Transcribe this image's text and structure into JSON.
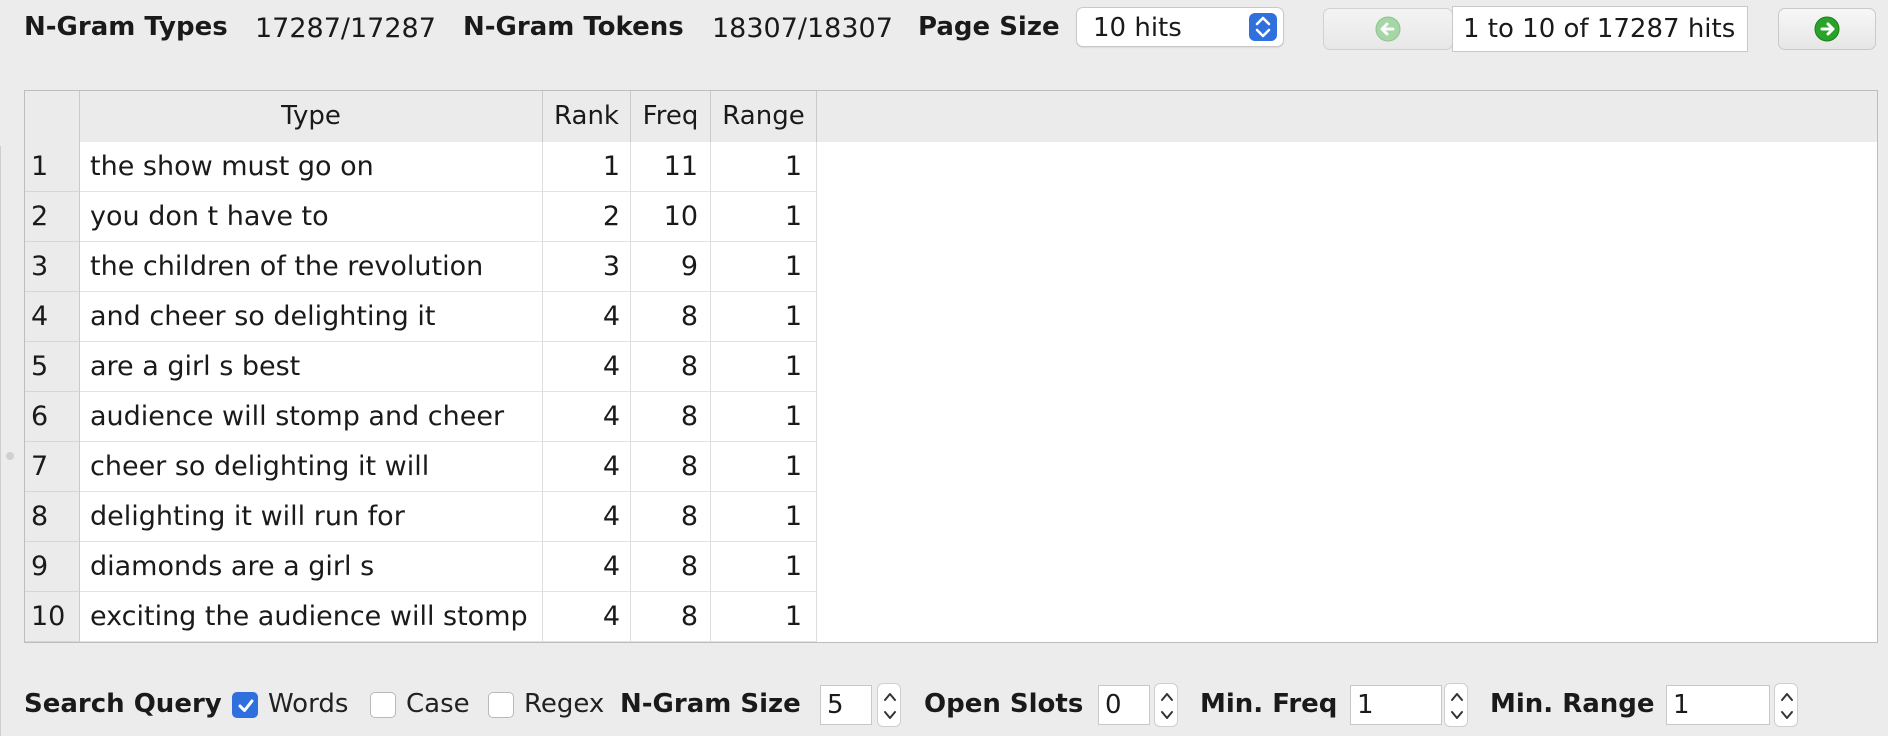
{
  "stats": {
    "types_label": "N-Gram Types",
    "types_value": "17287/17287",
    "tokens_label": "N-Gram Tokens",
    "tokens_value": "18307/18307"
  },
  "paging": {
    "page_size_label": "Page Size",
    "page_size_value": "10 hits",
    "hits_range": "1 to 10 of 17287 hits"
  },
  "table": {
    "headers": [
      "Type",
      "Rank",
      "Freq",
      "Range"
    ],
    "rows": [
      {
        "num": "1",
        "type": "the show must go on",
        "rank": "1",
        "freq": "11",
        "range": "1"
      },
      {
        "num": "2",
        "type": "you don t have to",
        "rank": "2",
        "freq": "10",
        "range": "1"
      },
      {
        "num": "3",
        "type": "the children of the revolution",
        "rank": "3",
        "freq": "9",
        "range": "1"
      },
      {
        "num": "4",
        "type": "and cheer so delighting it",
        "rank": "4",
        "freq": "8",
        "range": "1"
      },
      {
        "num": "5",
        "type": "are a girl s best",
        "rank": "4",
        "freq": "8",
        "range": "1"
      },
      {
        "num": "6",
        "type": "audience will stomp and cheer",
        "rank": "4",
        "freq": "8",
        "range": "1"
      },
      {
        "num": "7",
        "type": "cheer so delighting it will",
        "rank": "4",
        "freq": "8",
        "range": "1"
      },
      {
        "num": "8",
        "type": "delighting it will run for",
        "rank": "4",
        "freq": "8",
        "range": "1"
      },
      {
        "num": "9",
        "type": "diamonds are a girl s",
        "rank": "4",
        "freq": "8",
        "range": "1"
      },
      {
        "num": "10",
        "type": "exciting the audience will stomp",
        "rank": "4",
        "freq": "8",
        "range": "1"
      }
    ]
  },
  "search": {
    "query_label": "Search Query",
    "words_label": "Words",
    "words_checked": true,
    "case_label": "Case",
    "case_checked": false,
    "regex_label": "Regex",
    "regex_checked": false,
    "ngram_size_label": "N-Gram Size",
    "ngram_size_value": "5",
    "open_slots_label": "Open Slots",
    "open_slots_value": "0",
    "min_freq_label": "Min. Freq",
    "min_freq_value": "1",
    "min_range_label": "Min. Range",
    "min_range_value": "1"
  },
  "colors": {
    "accent": "#2f6fde",
    "nav_green": "#2aa32a"
  },
  "icons": {
    "prev": "arrow-left-circle-icon",
    "next": "arrow-right-circle-icon",
    "select": "chevron-updown-icon",
    "check": "checkmark-icon"
  }
}
